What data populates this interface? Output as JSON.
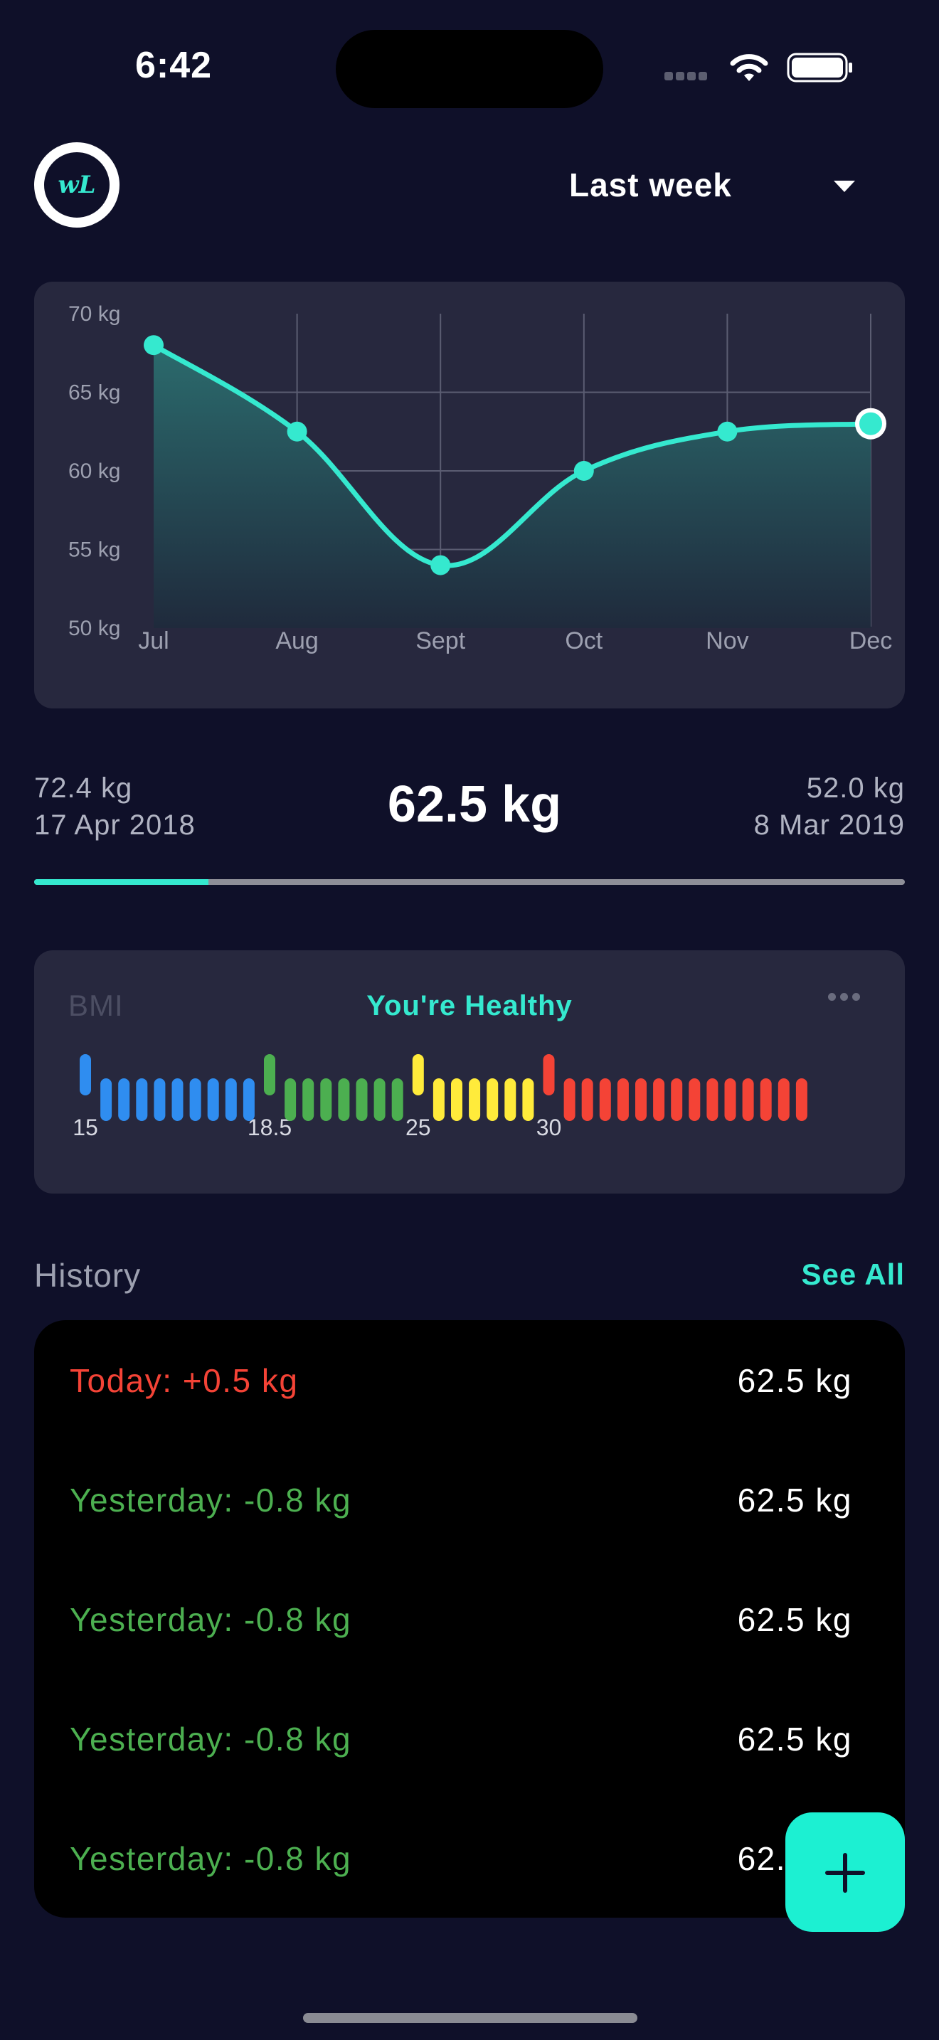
{
  "status_bar": {
    "time": "6:42"
  },
  "header": {
    "logo_text": "wL",
    "period": "Last week"
  },
  "chart_data": {
    "type": "line",
    "categories": [
      "Jul",
      "Aug",
      "Sept",
      "Oct",
      "Nov",
      "Dec"
    ],
    "values": [
      68,
      62.5,
      54,
      60,
      62.5,
      63
    ],
    "y_ticks": [
      "70 kg",
      "65 kg",
      "60 kg",
      "55 kg",
      "50 kg"
    ],
    "ylim": [
      50,
      70
    ],
    "grid": true,
    "colors": {
      "line": "#35e9cf",
      "fill_top": "#2b6b6d",
      "fill_bottom": "#1f2a3c",
      "grid": "#5b5d72"
    }
  },
  "summary": {
    "start_weight": "72.4 kg",
    "start_date": "17 Apr 2018",
    "current_weight": "62.5 kg",
    "end_weight": "52.0 kg",
    "end_date": "8 Mar 2019",
    "progress": 0.2
  },
  "bmi": {
    "title": "BMI",
    "status": "You're Healthy",
    "markers": [
      "15",
      "18.5",
      "25",
      "30"
    ],
    "segments": [
      {
        "color": "#2f8df0",
        "bars": 9
      },
      {
        "color": "#4caf50",
        "bars": 7
      },
      {
        "color": "#ffeb3b",
        "bars": 6
      },
      {
        "color": "#f44336",
        "bars": 14
      }
    ]
  },
  "history": {
    "title": "History",
    "see_all": "See All",
    "rows": [
      {
        "label": "Today: +0.5 kg",
        "value": "62.5 kg",
        "trend": "up"
      },
      {
        "label": "Yesterday: -0.8 kg",
        "value": "62.5 kg",
        "trend": "down"
      },
      {
        "label": "Yesterday: -0.8 kg",
        "value": "62.5 kg",
        "trend": "down"
      },
      {
        "label": "Yesterday: -0.8 kg",
        "value": "62.5 kg",
        "trend": "down"
      },
      {
        "label": "Yesterday: -0.8 kg",
        "value": "62.5 kg",
        "trend": "down"
      }
    ],
    "colors": {
      "up": "#f44336",
      "down": "#4caf50"
    }
  },
  "fab": {
    "icon": "plus-icon"
  }
}
